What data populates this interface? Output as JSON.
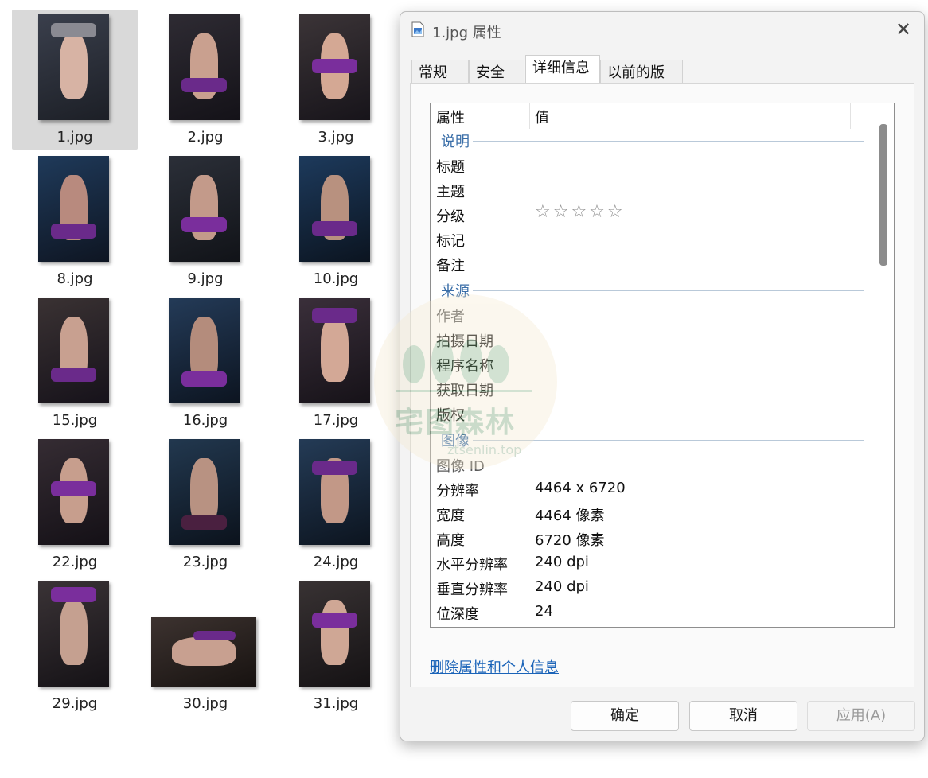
{
  "files": [
    {
      "name": "1.jpg",
      "selected": true
    },
    {
      "name": "2.jpg"
    },
    {
      "name": "3.jpg"
    },
    {
      "name": "8.jpg"
    },
    {
      "name": "9.jpg"
    },
    {
      "name": "10.jpg"
    },
    {
      "name": "15.jpg"
    },
    {
      "name": "16.jpg"
    },
    {
      "name": "17.jpg"
    },
    {
      "name": "22.jpg"
    },
    {
      "name": "23.jpg"
    },
    {
      "name": "24.jpg"
    },
    {
      "name": "29.jpg"
    },
    {
      "name": "30.jpg",
      "orientation": "landscape"
    },
    {
      "name": "31.jpg"
    }
  ],
  "dialog": {
    "title": "1.jpg 属性",
    "close_glyph": "✕",
    "tabs": [
      {
        "label": "常规"
      },
      {
        "label": "安全"
      },
      {
        "label": "详细信息",
        "active": true
      },
      {
        "label": "以前的版本"
      }
    ],
    "list": {
      "col_property": "属性",
      "col_value": "值",
      "groups": {
        "description": "说明",
        "origin": "来源",
        "image": "图像"
      },
      "rows": {
        "title": "标题",
        "subject": "主题",
        "rating": "分级",
        "rating_stars": "☆☆☆☆☆",
        "rating_value": 0,
        "tags": "标记",
        "comments": "备注",
        "authors": "作者",
        "date_taken": "拍摄日期",
        "program_name": "程序名称",
        "date_acquired": "获取日期",
        "copyright": "版权",
        "image_id": "图像 ID",
        "dimensions_label": "分辨率",
        "dimensions_value": "4464 x 6720",
        "width_label": "宽度",
        "width_value": "4464 像素",
        "height_label": "高度",
        "height_value": "6720 像素",
        "hres_label": "水平分辨率",
        "hres_value": "240 dpi",
        "vres_label": "垂直分辨率",
        "vres_value": "240 dpi",
        "bitdepth_label": "位深度",
        "bitdepth_value": "24"
      }
    },
    "remove_link": "删除属性和个人信息",
    "buttons": {
      "ok": "确定",
      "cancel": "取消",
      "apply": "应用(A)"
    }
  },
  "watermark": {
    "text": "宅图森林",
    "url": "ztsenlin.top"
  },
  "colors": {
    "link": "#1a63b8",
    "group_title": "#3a6ea8",
    "purple_outfit": "#6a2a8a",
    "dark_bg": "#1e2a3a"
  }
}
